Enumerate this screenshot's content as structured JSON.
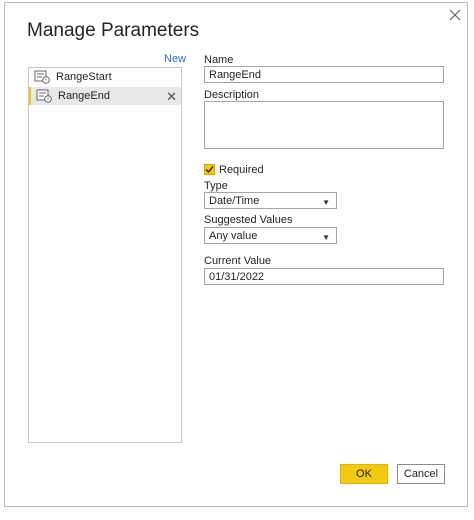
{
  "dialog": {
    "title": "Manage Parameters",
    "new_label": "New",
    "close_icon": "close-icon"
  },
  "parameters": [
    {
      "label": "RangeStart",
      "icon": "parameter-icon",
      "selected": false
    },
    {
      "label": "RangeEnd",
      "icon": "parameter-icon",
      "selected": true,
      "delete_glyph": "✕"
    }
  ],
  "form": {
    "name_label": "Name",
    "name_value": "RangeEnd",
    "description_label": "Description",
    "description_value": "",
    "required_label": "Required",
    "required_checked": true,
    "type_label": "Type",
    "type_value": "Date/Time",
    "suggested_label": "Suggested Values",
    "suggested_value": "Any value",
    "current_label": "Current Value",
    "current_value": "01/31/2022"
  },
  "buttons": {
    "ok": "OK",
    "cancel": "Cancel"
  },
  "colors": {
    "accent": "#f2c811",
    "link": "#2f6fb6"
  }
}
